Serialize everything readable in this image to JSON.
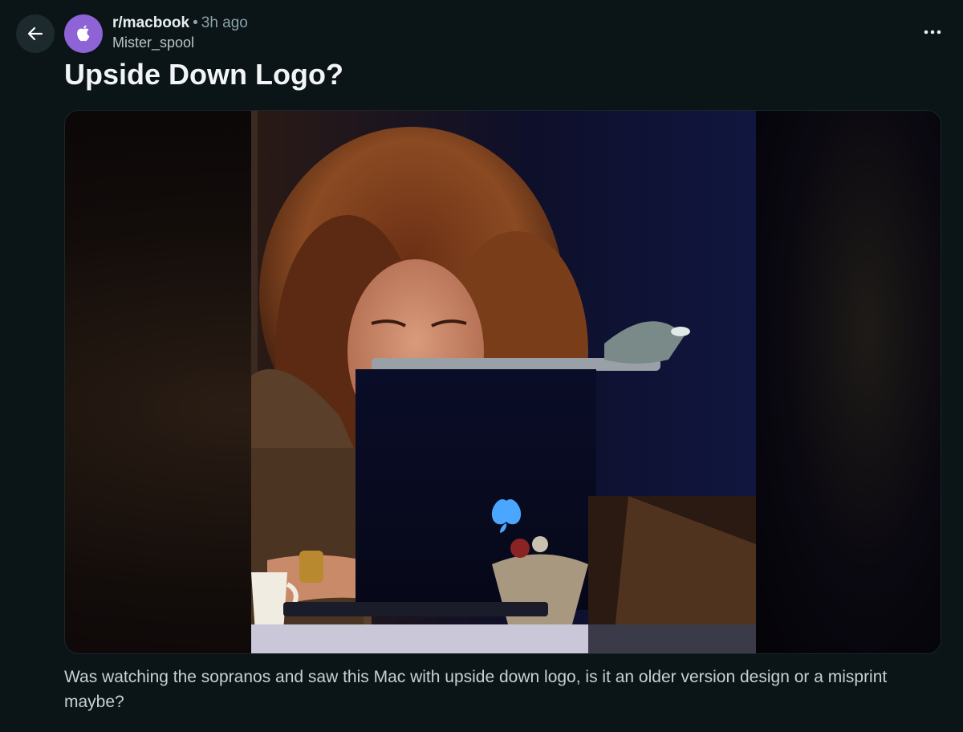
{
  "post": {
    "subreddit": "r/macbook",
    "separator": "•",
    "time_ago": "3h ago",
    "author": "Mister_spool",
    "title": "Upside Down Logo?",
    "body": "Was watching the sopranos and saw this Mac with upside down logo, is it an older version design or a misprint maybe?"
  },
  "icons": {
    "back": "arrow-left-icon",
    "avatar": "apple-logo-icon",
    "more": "more-horizontal-icon"
  },
  "colors": {
    "background": "#0b1416",
    "avatar_bg": "#8e63d6",
    "back_button_bg": "#1c2a2d",
    "muted_text": "#8ba2ad"
  }
}
